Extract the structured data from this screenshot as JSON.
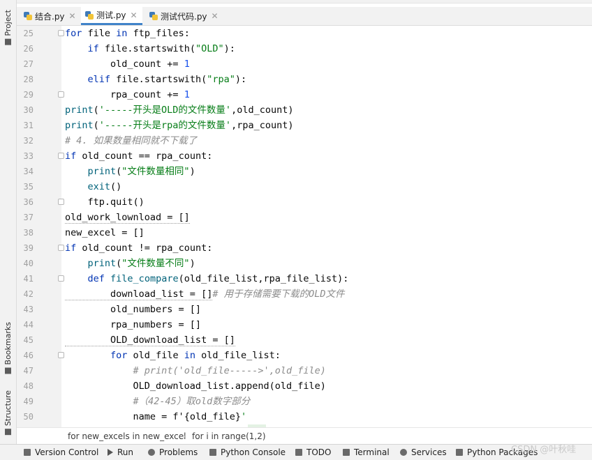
{
  "tabs": [
    {
      "label": "结合.py",
      "active": false
    },
    {
      "label": "测试.py",
      "active": true
    },
    {
      "label": "测试代码.py",
      "active": false
    }
  ],
  "side_tabs": {
    "project": "Project",
    "bookmarks": "Bookmarks",
    "structure": "Structure"
  },
  "line_numbers": [
    "25",
    "26",
    "27",
    "28",
    "29",
    "30",
    "31",
    "32",
    "33",
    "34",
    "35",
    "36",
    "37",
    "38",
    "39",
    "40",
    "41",
    "42",
    "43",
    "44",
    "45",
    "46",
    "47",
    "48",
    "49",
    "50"
  ],
  "breadcrumbs": [
    "for new_excels in new_excel",
    "for i in range(1,2)"
  ],
  "bottom_tools": [
    "Version Control",
    "Run",
    "Problems",
    "Python Console",
    "TODO",
    "Terminal",
    "Services",
    "Python Packages"
  ],
  "watermark": "CSDN @叶秋哇",
  "colors": {
    "accent": "#4083c9",
    "keyword": "#0033b3",
    "string": "#067d17",
    "number": "#1750eb",
    "comment": "#8c8c8c"
  },
  "code": [
    [
      [
        "kw",
        "for"
      ],
      [
        "pl",
        " file "
      ],
      [
        "kw",
        "in"
      ],
      [
        "pl",
        " ftp_files:"
      ]
    ],
    [
      [
        "pl",
        "    "
      ],
      [
        "kw",
        "if"
      ],
      [
        "pl",
        " file.startswith("
      ],
      [
        "str",
        "\"OLD\""
      ],
      [
        "pl",
        "):"
      ]
    ],
    [
      [
        "pl",
        "        old_count += "
      ],
      [
        "num",
        "1"
      ]
    ],
    [
      [
        "pl",
        "    "
      ],
      [
        "kw",
        "elif"
      ],
      [
        "pl",
        " file.startswith("
      ],
      [
        "str",
        "\"rpa\""
      ],
      [
        "pl",
        "):"
      ]
    ],
    [
      [
        "pl",
        "        rpa_count += "
      ],
      [
        "num",
        "1"
      ]
    ],
    [
      [
        "fn",
        "print"
      ],
      [
        "pl",
        "("
      ],
      [
        "str",
        "'-----开头是OLD的文件数量'"
      ],
      [
        "pl",
        ",old_count)"
      ]
    ],
    [
      [
        "fn",
        "print"
      ],
      [
        "pl",
        "("
      ],
      [
        "str",
        "'-----开头是rpa的文件数量'"
      ],
      [
        "pl",
        ",rpa_count)"
      ]
    ],
    [
      [
        "cm",
        "# 4. 如果数量相同就不下载了"
      ]
    ],
    [
      [
        "kw",
        "if"
      ],
      [
        "pl",
        " old_count == rpa_count:"
      ]
    ],
    [
      [
        "pl",
        "    "
      ],
      [
        "fn",
        "print"
      ],
      [
        "pl",
        "("
      ],
      [
        "str",
        "\"文件数量相同\""
      ],
      [
        "pl",
        ")"
      ]
    ],
    [
      [
        "pl",
        "    "
      ],
      [
        "fn",
        "exit"
      ],
      [
        "pl",
        "()"
      ]
    ],
    [
      [
        "pl",
        "    ftp.quit()"
      ]
    ],
    [
      [
        "pl",
        "old_work_lownload = []"
      ]
    ],
    [
      [
        "pl",
        "new_excel = []"
      ]
    ],
    [
      [
        "kw",
        "if"
      ],
      [
        "pl",
        " old_count != rpa_count:"
      ]
    ],
    [
      [
        "pl",
        "    "
      ],
      [
        "fn",
        "print"
      ],
      [
        "pl",
        "("
      ],
      [
        "str",
        "\"文件数量不同\""
      ],
      [
        "pl",
        ")"
      ]
    ],
    [
      [
        "pl",
        "    "
      ],
      [
        "kw",
        "def"
      ],
      [
        "pl",
        " "
      ],
      [
        "fn",
        "file_compare"
      ],
      [
        "pl",
        "(old_file_list,rpa_file_list):"
      ]
    ],
    [
      [
        "pl",
        "        download_list = []"
      ],
      [
        "cm",
        "# 用于存储需要下载的OLD文件"
      ]
    ],
    [
      [
        "pl",
        "        old_numbers = []"
      ]
    ],
    [
      [
        "pl",
        "        rpa_numbers = []"
      ]
    ],
    [
      [
        "pl",
        "        OLD_download_list = []"
      ]
    ],
    [
      [
        "pl",
        "        "
      ],
      [
        "kw",
        "for"
      ],
      [
        "pl",
        " old_file "
      ],
      [
        "kw",
        "in"
      ],
      [
        "pl",
        " old_file_list:"
      ]
    ],
    [
      [
        "pl",
        "            "
      ],
      [
        "cm",
        "# print('old_file----->',old_file)"
      ]
    ],
    [
      [
        "pl",
        "            OLD_download_list.append(old_file)"
      ]
    ],
    [
      [
        "pl",
        "            "
      ],
      [
        "cm",
        "#（42-45）取old数字部分"
      ]
    ],
    [
      [
        "pl",
        "            name = f'"
      ],
      [
        "pl",
        "{old_file}"
      ],
      [
        "str",
        "'"
      ]
    ]
  ]
}
